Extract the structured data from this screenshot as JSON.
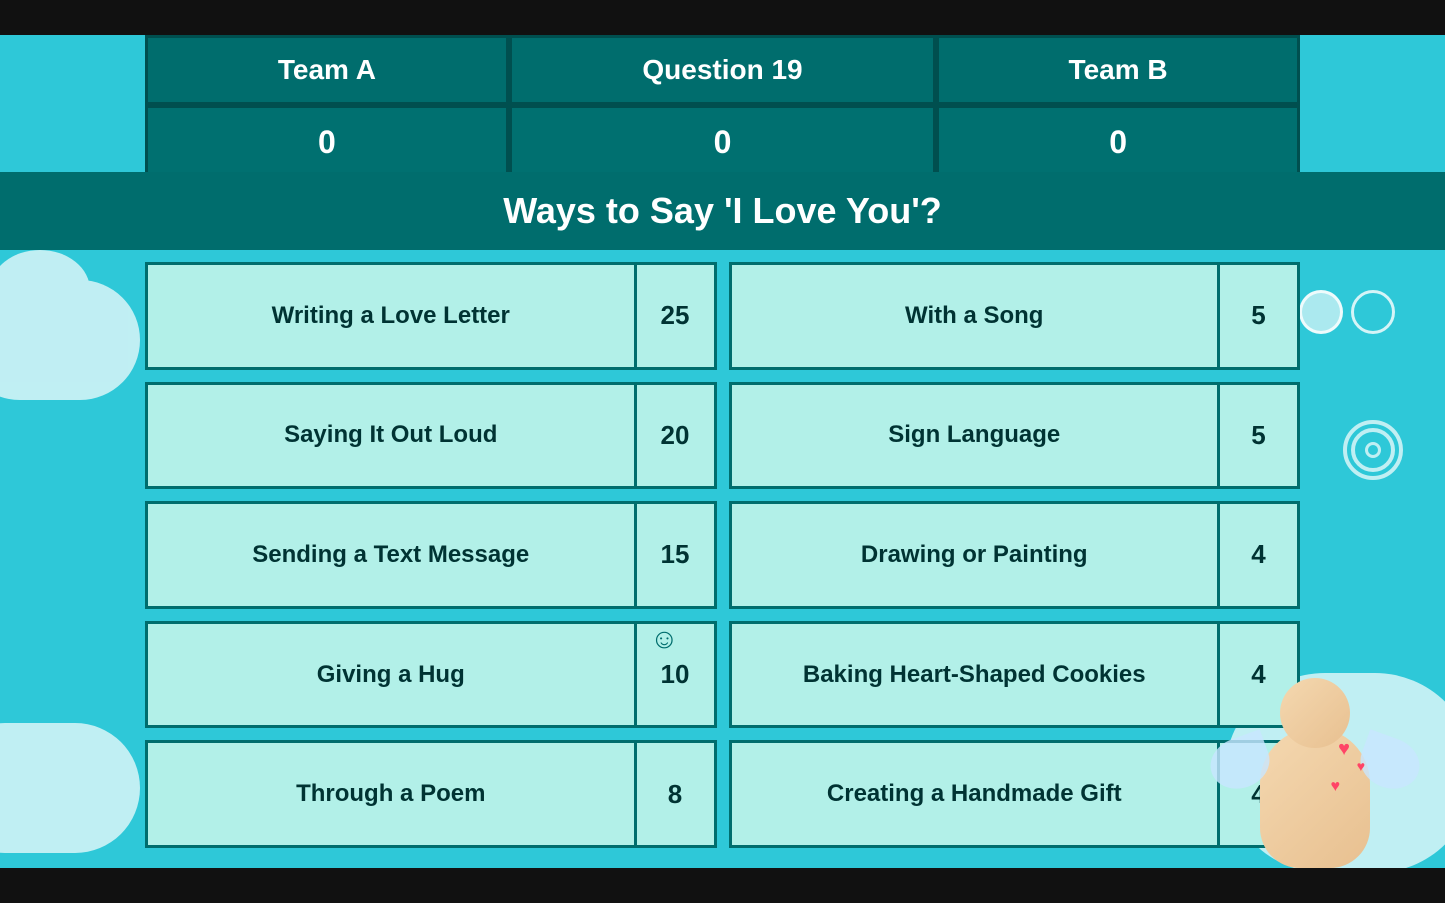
{
  "blackBars": true,
  "header": {
    "teamA": {
      "label": "Team A",
      "score": "0"
    },
    "question": {
      "label": "Question 19",
      "score": "0"
    },
    "teamB": {
      "label": "Team B",
      "score": "0"
    }
  },
  "categoryBanner": {
    "text": "Ways to Say 'I Love You'?"
  },
  "answers": [
    {
      "left": {
        "text": "Writing a Love Letter",
        "score": "25"
      },
      "right": {
        "text": "With a Song",
        "score": "5"
      }
    },
    {
      "left": {
        "text": "Saying It Out Loud",
        "score": "20"
      },
      "right": {
        "text": "Sign Language",
        "score": "5"
      }
    },
    {
      "left": {
        "text": "Sending a Text Message",
        "score": "15"
      },
      "right": {
        "text": "Drawing or Painting",
        "score": "4"
      }
    },
    {
      "left": {
        "text": "Giving a Hug",
        "score": "10"
      },
      "right": {
        "text": "Baking Heart-Shaped Cookies",
        "score": "4"
      }
    },
    {
      "left": {
        "text": "Through a Poem",
        "score": "8"
      },
      "right": {
        "text": "Creating a Handmade Gift",
        "score": "4"
      }
    }
  ]
}
